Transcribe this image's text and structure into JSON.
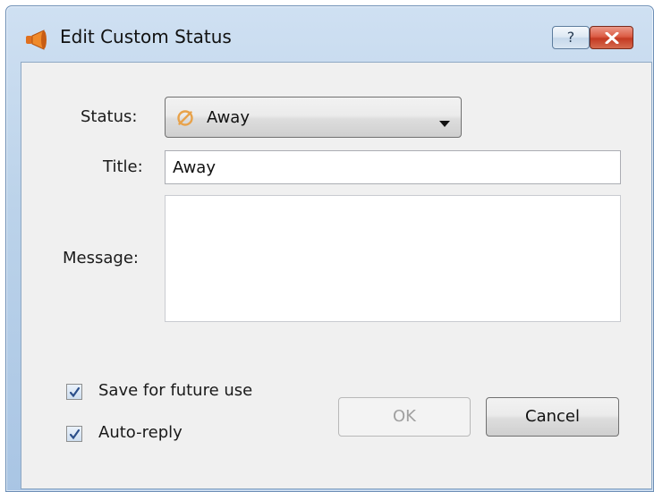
{
  "window": {
    "title": "Edit Custom Status",
    "title_icon": "megaphone-icon",
    "help_label": "?",
    "close_icon": "close-icon"
  },
  "form": {
    "status_label": "Status:",
    "status_value": "Away",
    "status_icon": "away-status-icon",
    "status_icon_color": "#e8a24a",
    "title_label": "Title:",
    "title_value": "Away",
    "message_label": "Message:",
    "message_value": ""
  },
  "options": {
    "save_label": "Save for future use",
    "save_checked": true,
    "autoreply_label": "Auto-reply",
    "autoreply_checked": true
  },
  "buttons": {
    "ok_label": "OK",
    "ok_enabled": false,
    "cancel_label": "Cancel"
  },
  "colors": {
    "close_button": "#c43a22",
    "checkmark": "#2b4f8a",
    "dialog_background": "#f0f0f0",
    "frame": "#bcd3ea"
  }
}
